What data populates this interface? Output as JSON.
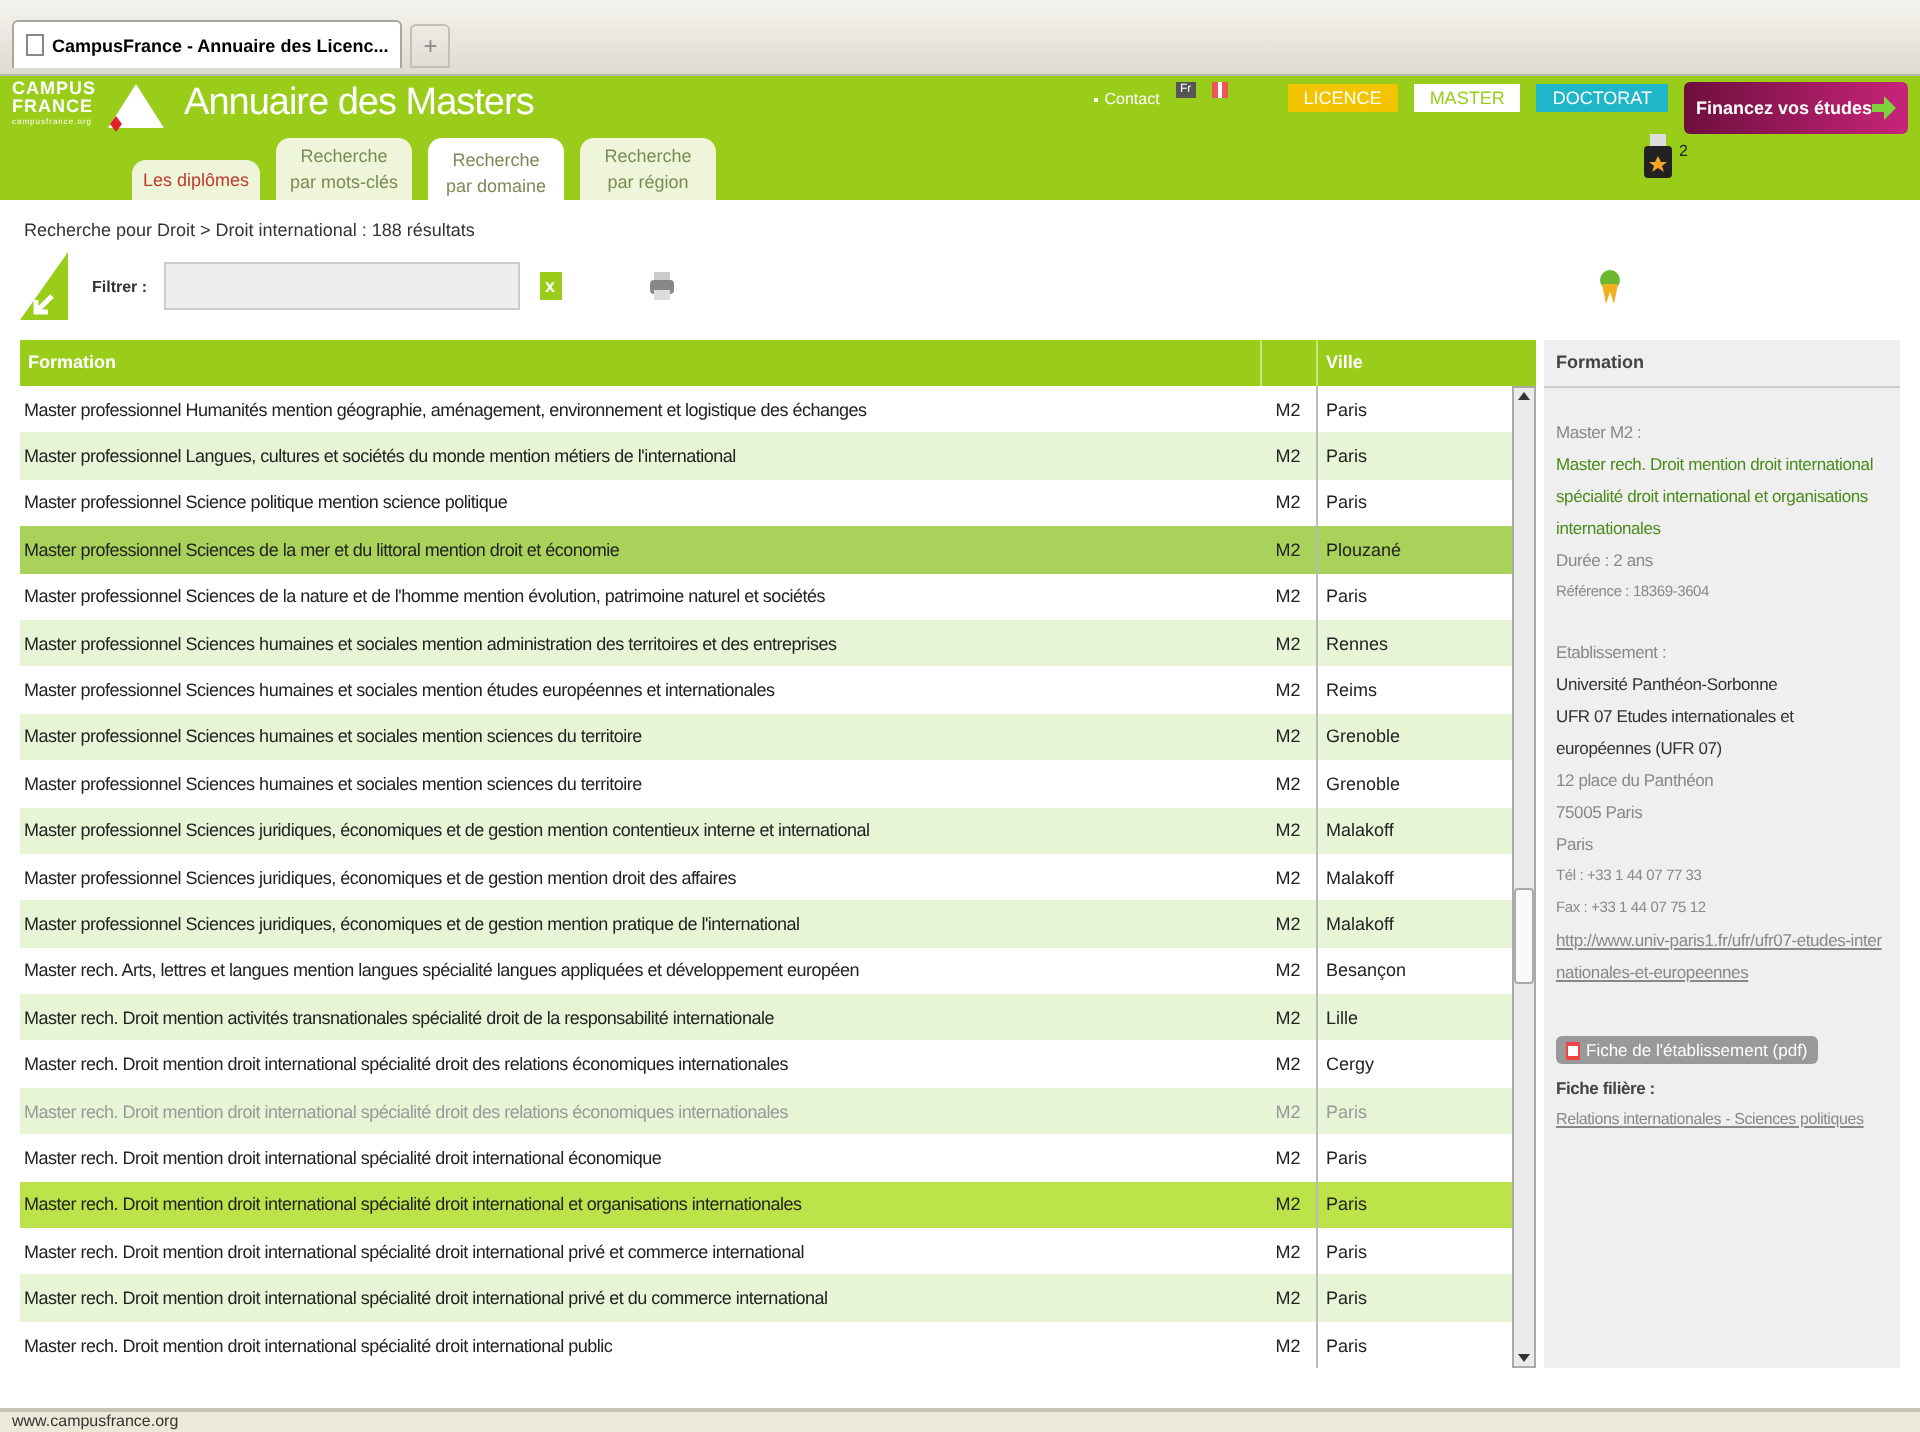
{
  "browser": {
    "tab_title": "CampusFrance - Annuaire des Licenc...",
    "new_tab": "+"
  },
  "header": {
    "logo": {
      "line1": "CAMPUS",
      "line2": "FRANCE",
      "site": "campusfrance.org"
    },
    "title": "Annuaire des Masters",
    "tabs": [
      {
        "label": "Les diplômes",
        "kind": "home",
        "selected": false
      },
      {
        "label": "Recherche\npar mots-clés",
        "kind": "search",
        "selected": false
      },
      {
        "label": "Recherche\npar domaine",
        "kind": "search",
        "selected": true
      },
      {
        "label": "Recherche\npar région",
        "kind": "search",
        "selected": false
      }
    ],
    "contact": "Contact",
    "lang": "Fr",
    "levels": [
      {
        "label": "LICENCE",
        "color": "#f5c400"
      },
      {
        "label": "MASTER",
        "color": "#ffffff"
      },
      {
        "label": "DOCTORAT",
        "color": "#1fb6c9"
      }
    ],
    "finance": "Financez vos études",
    "basket_count": "2"
  },
  "breadcrumb": "Recherche pour Droit > Droit international : 188 résultats",
  "filter": {
    "label": "Filtrer :",
    "clear": "x"
  },
  "table": {
    "columns": [
      "Formation",
      "Ville"
    ],
    "rows": [
      {
        "formation": "Master professionnel Humanités mention géographie, aménagement, environnement et logistique des échanges",
        "level": "M2",
        "city": "Paris",
        "selected": false,
        "hovered": false,
        "dimmed": false
      },
      {
        "formation": "Master professionnel Langues, cultures et sociétés du monde mention métiers de l'international",
        "level": "M2",
        "city": "Paris",
        "selected": false,
        "hovered": false,
        "dimmed": false
      },
      {
        "formation": "Master professionnel Science politique mention science politique",
        "level": "M2",
        "city": "Paris",
        "selected": false,
        "hovered": false,
        "dimmed": false
      },
      {
        "formation": "Master professionnel Sciences de la mer et du littoral mention droit et économie",
        "level": "M2",
        "city": "Plouzané",
        "selected": false,
        "hovered": true,
        "dimmed": false
      },
      {
        "formation": "Master professionnel Sciences de la nature et de l'homme mention évolution, patrimoine naturel et sociétés",
        "level": "M2",
        "city": "Paris",
        "selected": false,
        "hovered": false,
        "dimmed": false
      },
      {
        "formation": "Master professionnel Sciences humaines et sociales mention administration des territoires et des entreprises",
        "level": "M2",
        "city": "Rennes",
        "selected": false,
        "hovered": false,
        "dimmed": false
      },
      {
        "formation": "Master professionnel Sciences humaines et sociales mention études européennes et internationales",
        "level": "M2",
        "city": "Reims",
        "selected": false,
        "hovered": false,
        "dimmed": false
      },
      {
        "formation": "Master professionnel Sciences humaines et sociales mention sciences du territoire",
        "level": "M2",
        "city": "Grenoble",
        "selected": false,
        "hovered": false,
        "dimmed": false
      },
      {
        "formation": "Master professionnel Sciences humaines et sociales mention sciences du territoire",
        "level": "M2",
        "city": "Grenoble",
        "selected": false,
        "hovered": false,
        "dimmed": false
      },
      {
        "formation": "Master professionnel Sciences juridiques, économiques et de gestion mention contentieux interne et international",
        "level": "M2",
        "city": "Malakoff",
        "selected": false,
        "hovered": false,
        "dimmed": false
      },
      {
        "formation": "Master professionnel Sciences juridiques, économiques et de gestion mention droit des affaires",
        "level": "M2",
        "city": "Malakoff",
        "selected": false,
        "hovered": false,
        "dimmed": false
      },
      {
        "formation": "Master professionnel Sciences juridiques, économiques et de gestion mention pratique de l'international",
        "level": "M2",
        "city": "Malakoff",
        "selected": false,
        "hovered": false,
        "dimmed": false
      },
      {
        "formation": "Master rech. Arts, lettres et langues mention langues spécialité langues appliquées et développement européen",
        "level": "M2",
        "city": "Besançon",
        "selected": false,
        "hovered": false,
        "dimmed": false
      },
      {
        "formation": "Master rech. Droit mention activités transnationales spécialité droit de la responsabilité internationale",
        "level": "M2",
        "city": "Lille",
        "selected": false,
        "hovered": false,
        "dimmed": false
      },
      {
        "formation": "Master rech. Droit mention droit international spécialité droit des relations économiques internationales",
        "level": "M2",
        "city": "Cergy",
        "selected": false,
        "hovered": false,
        "dimmed": false
      },
      {
        "formation": "Master rech. Droit mention droit international spécialité droit des relations économiques internationales",
        "level": "M2",
        "city": "Paris",
        "selected": false,
        "hovered": false,
        "dimmed": true
      },
      {
        "formation": "Master rech. Droit mention droit international spécialité droit international économique",
        "level": "M2",
        "city": "Paris",
        "selected": false,
        "hovered": false,
        "dimmed": false
      },
      {
        "formation": "Master rech. Droit mention droit international spécialité droit international et organisations internationales",
        "level": "M2",
        "city": "Paris",
        "selected": true,
        "hovered": false,
        "dimmed": false
      },
      {
        "formation": "Master rech. Droit mention droit international spécialité droit international privé et commerce international",
        "level": "M2",
        "city": "Paris",
        "selected": false,
        "hovered": false,
        "dimmed": false
      },
      {
        "formation": "Master rech. Droit mention droit international spécialité droit international privé et du commerce international",
        "level": "M2",
        "city": "Paris",
        "selected": false,
        "hovered": false,
        "dimmed": false
      },
      {
        "formation": "Master rech. Droit mention droit international spécialité droit international public",
        "level": "M2",
        "city": "Paris",
        "selected": false,
        "hovered": false,
        "dimmed": false
      }
    ]
  },
  "detail": {
    "heading": "Formation",
    "level_label": "Master M2 :",
    "title": "Master rech. Droit mention droit international spécialité droit international et organisations internationales",
    "duration": "Durée : 2 ans",
    "reference": "Référence : 18369-3604",
    "establishment_label": "Etablissement :",
    "university": "Université Panthéon-Sorbonne",
    "ufr": "UFR 07 Etudes internationales et européennes (UFR 07)",
    "address": [
      "12 place du Panthéon",
      "75005 Paris",
      "Paris"
    ],
    "tel": "Tél : +33 1 44 07 77 33",
    "fax": "Fax : +33 1 44 07 75 12",
    "url": "http://www.univ-paris1.fr/ufr/ufr07-etudes-internationales-et-europeennes",
    "pdf_button": "Fiche de l'établissement (pdf)",
    "filiere_label": "Fiche filière :",
    "filiere_link": "Relations internationales - Sciences politiques"
  },
  "status_bar": "www.campusfrance.org"
}
